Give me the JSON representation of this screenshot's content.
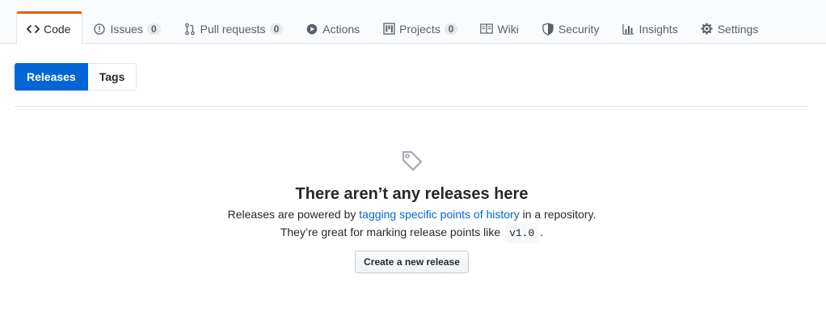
{
  "reponav": {
    "tabs": [
      {
        "label": "Code",
        "icon": "code-icon",
        "selected": true
      },
      {
        "label": "Issues",
        "icon": "issue-opened-icon",
        "counter": "0"
      },
      {
        "label": "Pull requests",
        "icon": "git-pull-request-icon",
        "counter": "0"
      },
      {
        "label": "Actions",
        "icon": "play-icon"
      },
      {
        "label": "Projects",
        "icon": "project-icon",
        "counter": "0"
      },
      {
        "label": "Wiki",
        "icon": "book-icon"
      },
      {
        "label": "Security",
        "icon": "shield-icon"
      },
      {
        "label": "Insights",
        "icon": "graph-icon"
      },
      {
        "label": "Settings",
        "icon": "gear-icon"
      }
    ]
  },
  "subnav": {
    "releases_label": "Releases",
    "tags_label": "Tags",
    "selected": "Releases"
  },
  "blankslate": {
    "icon": "tag-icon",
    "title": "There aren’t any releases here",
    "line1_prefix": "Releases are powered by ",
    "line1_link": "tagging specific points of history",
    "line1_suffix": " in a repository.",
    "line2_prefix": "They’re great for marking release points like ",
    "line2_code": "v1.0",
    "line2_suffix": ".",
    "button_label": "Create a new release"
  },
  "colors": {
    "accent_blue": "#0366d6",
    "selected_tab_border": "#e36209",
    "muted_text": "#586069"
  }
}
